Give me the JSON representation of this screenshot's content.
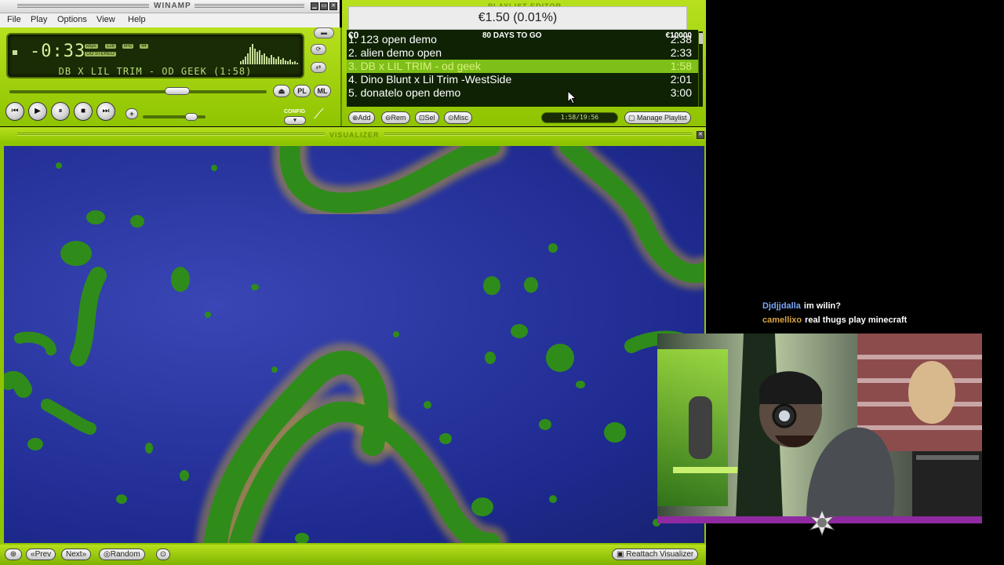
{
  "winamp": {
    "title": "WINAMP",
    "menu": [
      "File",
      "Play",
      "Options",
      "View",
      "Help"
    ],
    "timer": "-0:33",
    "kbps": "kbps",
    "kbps_value": "128",
    "khz": "kHz",
    "khz_value": "44",
    "stereo": "OO STEREO",
    "track_display": "DB X LIL TRIM - OD GEEK (1:58)",
    "seek_fraction": 0.67,
    "volume_fraction": 0.85,
    "buttons": {
      "eject_icon": "eject-icon",
      "pl": "PL",
      "ml": "ML",
      "config": "CONFIG"
    }
  },
  "playlist": {
    "title": "PLAYLIST EDITOR",
    "donation": "€1.50 (0.01%)",
    "goal_left": "€0",
    "goal_center": "80 DAYS TO GO",
    "goal_right": "€10000",
    "items": [
      {
        "name": "1. 123 open demo",
        "duration": "2:38"
      },
      {
        "name": "2. alien demo open",
        "duration": "2:33"
      },
      {
        "name": "3. DB x LIL TRIM - od geek",
        "duration": "1:58",
        "active": true
      },
      {
        "name": "4. Dino Blunt x Lil Trim -WestSide",
        "duration": "2:01"
      },
      {
        "name": "5. donatelo open demo",
        "duration": "3:00"
      }
    ],
    "buttons": {
      "add": "Add",
      "rem": "Rem",
      "sel": "Sel",
      "misc": "Misc",
      "time": "1:58/19:56",
      "manage": "Manage Playlist"
    }
  },
  "visualizer": {
    "title": "VISUALIZER",
    "prev": "Prev",
    "next": "Next",
    "random": "Random",
    "reattach": "Reattach Visualizer"
  },
  "chat": [
    {
      "user": "Djdjjdalla",
      "message": "im wilin?",
      "color": "#7aa7f7"
    },
    {
      "user": "camellixo",
      "message": "real thugs play minecraft",
      "color": "#d9a441"
    }
  ],
  "colors": {
    "skin_green": "#8fc400",
    "lcd_dark": "#1a2c05",
    "active_row": "#7fbf1a",
    "viz_blue": "#1e2a8f",
    "cam_bar": "#8f2aa0"
  }
}
